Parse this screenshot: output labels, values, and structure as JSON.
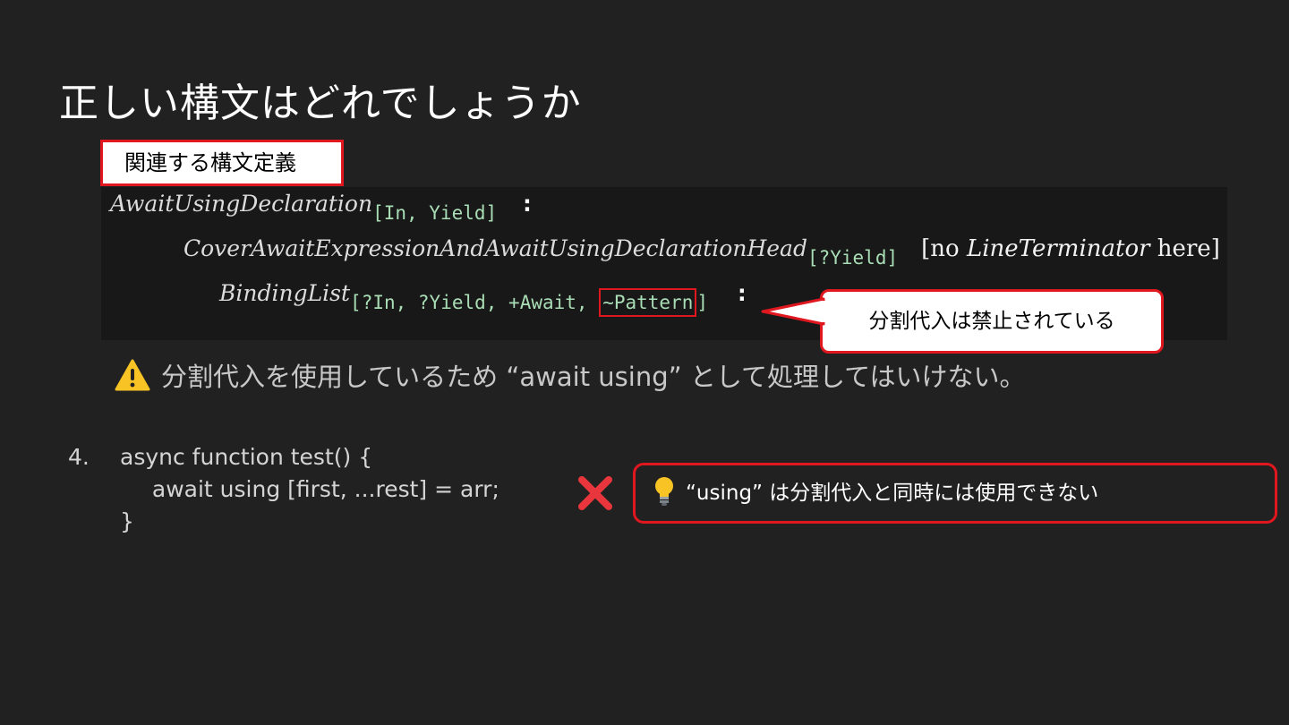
{
  "slide": {
    "title": "正しい構文はどれでしょうか",
    "section_label": "関連する構文定義"
  },
  "grammar": {
    "line1": {
      "nonterminal": "AwaitUsingDeclaration",
      "params": "[In, Yield]",
      "colon": ":"
    },
    "line2": {
      "nonterminal": "CoverAwaitExpressionAndAwaitUsingDeclarationHead",
      "params": "[?Yield]",
      "restriction_prefix": "[no ",
      "restriction_nonterminal": "LineTerminator",
      "restriction_suffix": " here]"
    },
    "line3": {
      "nonterminal": "BindingList",
      "params_prefix": "[?In, ?Yield, +Await, ",
      "params_highlight": "~Pattern",
      "params_suffix": "]",
      "colon": ":"
    }
  },
  "callout": {
    "text": "分割代入は禁止されている"
  },
  "warning": {
    "icon": "warning-icon",
    "text": "分割代入を使用しているため “await using” として処理してはいけない。"
  },
  "example": {
    "number": "4.",
    "code_lines": [
      "async function test() {",
      "  await using [first, ...rest] = arr;",
      "}"
    ],
    "verdict_icon": "cross-icon"
  },
  "tip": {
    "icon": "lightbulb-icon",
    "text": "“using” は分割代入と同時には使用できない"
  },
  "colors": {
    "background": "#212121",
    "panel": "#181818",
    "accent_red": "#e0171f",
    "param_green": "#a9ddb5",
    "warning_yellow": "#f7c325"
  }
}
